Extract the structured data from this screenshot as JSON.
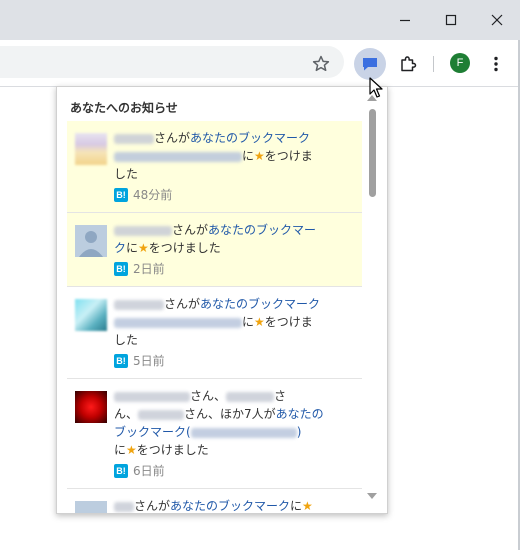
{
  "toolbar": {
    "profile_initial": "F"
  },
  "popup": {
    "title": "あなたへのお知らせ",
    "items": [
      {
        "text_1": "さんが",
        "link_1": "あなたのブックマーク",
        "text_2": "に",
        "star": "★",
        "text_3": "をつけま",
        "text_4": "した",
        "badge": "B!",
        "time": "48分前",
        "unread": true
      },
      {
        "text_1": "さんが",
        "link_1": "あなたのブックマー",
        "link_2": "ク",
        "text_2": "に",
        "star": "★",
        "text_3": "をつけました",
        "badge": "B!",
        "time": "2日前",
        "unread": true
      },
      {
        "text_1": "さんが",
        "link_1": "あなたのブックマーク",
        "text_2": "に",
        "star": "★",
        "text_3": "をつけま",
        "text_4": "した",
        "badge": "B!",
        "time": "5日前",
        "unread": false
      },
      {
        "text_1": "さん、",
        "text_2": "さ",
        "text_3": "ん、",
        "text_4": "さん、ほか7人が",
        "link_1": "あなたの",
        "link_2": "ブックマーク(",
        "link_3": ")",
        "text_5": "に",
        "star": "★",
        "text_6": "をつけました",
        "badge": "B!",
        "time": "6日前",
        "unread": false
      },
      {
        "text_1": "さんが",
        "link_1": "あなたのブックマーク",
        "text_2": "に",
        "star": "★",
        "unread": false
      }
    ]
  }
}
